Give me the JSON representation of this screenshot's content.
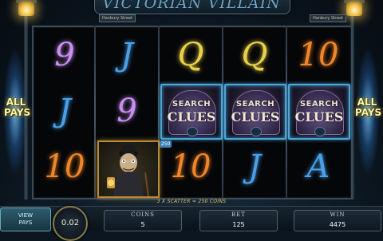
{
  "header": {
    "title": "VICTORIAN VILLAIN",
    "street_left": "Hanbury Street",
    "street_right": "Hanbury Street"
  },
  "side": {
    "left_label": "ALL PAYS",
    "right_label": "ALL PAYS"
  },
  "reels": [
    [
      "9",
      "J",
      "10"
    ],
    [
      "J",
      "9",
      "villain"
    ],
    [
      "Q",
      "scatter",
      "10"
    ],
    [
      "Q",
      "scatter",
      "J"
    ],
    [
      "10",
      "scatter",
      "A"
    ]
  ],
  "symbol_colors": {
    "9": "#c78ff0",
    "J": "#4aa0e8",
    "Q": "#e9d04a",
    "10": "#f0862a",
    "A": "#4aa0e8"
  },
  "scatter": {
    "word1": "SEARCH",
    "word2": "CLUES"
  },
  "badge": {
    "value": "250"
  },
  "win_line": "3 X SCATTER = 250 COINS",
  "bottom": {
    "view_pays": "VIEW\nPAYS",
    "timer": "0.02",
    "coins_label": "COINS",
    "coins_value": "5",
    "bet_label": "BET",
    "bet_value": "125",
    "win_label": "WIN",
    "win_value": "4475"
  }
}
